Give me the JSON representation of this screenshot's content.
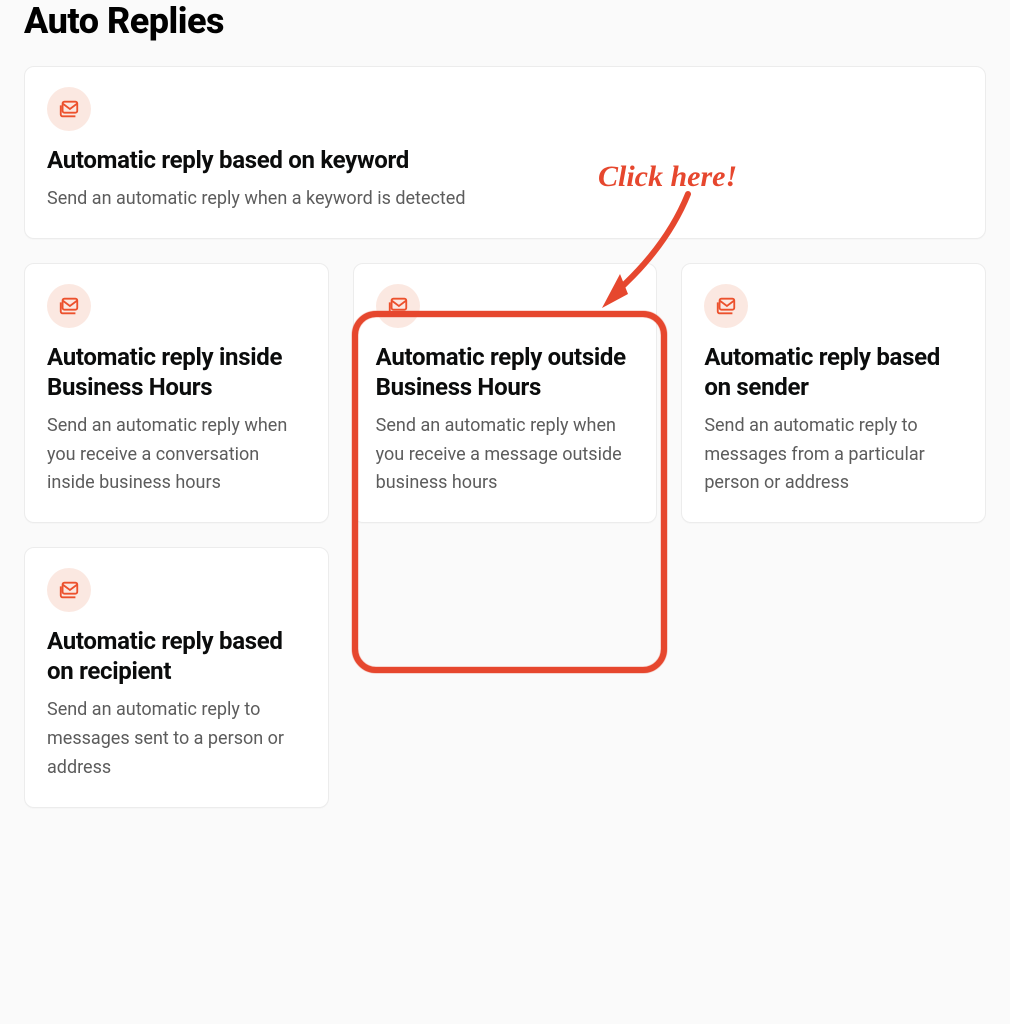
{
  "section_title": "Auto Replies",
  "cards": {
    "keyword": {
      "title": "Automatic reply based on keyword",
      "desc": "Send an automatic reply when a keyword is detected"
    },
    "inside_hours": {
      "title": "Automatic reply inside Business Hours",
      "desc": "Send an automatic reply when you receive a conversation inside business hours"
    },
    "outside_hours": {
      "title": "Automatic reply outside Business Hours",
      "desc": "Send an automatic reply when you receive a message outside business hours"
    },
    "sender": {
      "title": "Automatic reply based on sender",
      "desc": "Send an automatic reply to messages from a particular person or address"
    },
    "recipient": {
      "title": "Automatic reply based on recipient",
      "desc": "Send an automatic reply to messages sent to a person or address"
    }
  },
  "annotation": {
    "label": "Click here!"
  }
}
